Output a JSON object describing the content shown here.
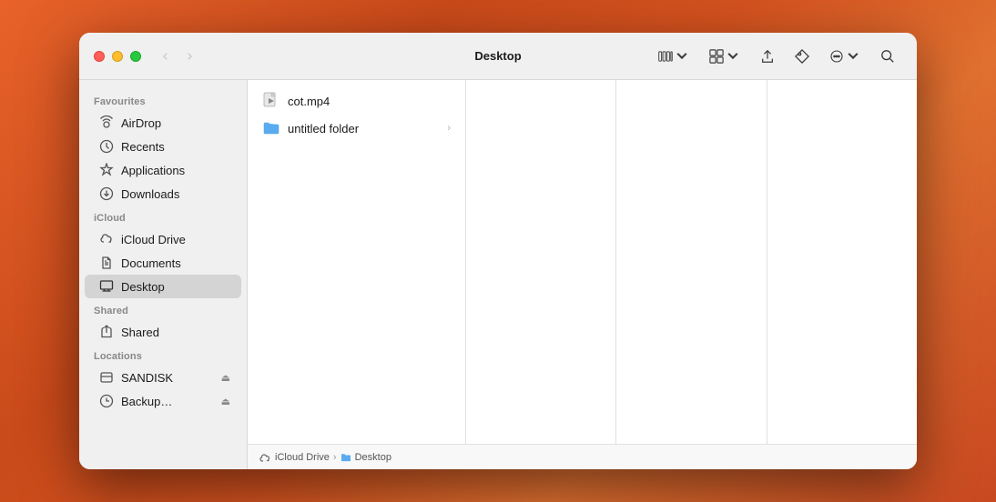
{
  "window": {
    "title": "Desktop"
  },
  "traffic_lights": {
    "close_label": "close",
    "minimize_label": "minimize",
    "maximize_label": "maximize"
  },
  "nav": {
    "back_label": "‹",
    "forward_label": "›"
  },
  "toolbar": {
    "view_columns_label": "⊞",
    "view_toggle_label": "⊟",
    "share_label": "⬆",
    "tag_label": "⬡",
    "more_label": "⊙",
    "search_label": "⌕"
  },
  "sidebar": {
    "favourites_label": "Favourites",
    "icloud_label": "iCloud",
    "shared_label": "Shared",
    "locations_label": "Locations",
    "items": [
      {
        "id": "airdrop",
        "label": "AirDrop",
        "icon": "airdrop"
      },
      {
        "id": "recents",
        "label": "Recents",
        "icon": "recents"
      },
      {
        "id": "applications",
        "label": "Applications",
        "icon": "applications"
      },
      {
        "id": "downloads",
        "label": "Downloads",
        "icon": "downloads"
      }
    ],
    "icloud_items": [
      {
        "id": "icloud-drive",
        "label": "iCloud Drive",
        "icon": "cloud"
      },
      {
        "id": "documents",
        "label": "Documents",
        "icon": "document"
      },
      {
        "id": "desktop",
        "label": "Desktop",
        "icon": "desktop",
        "active": true
      }
    ],
    "shared_items": [
      {
        "id": "shared",
        "label": "Shared",
        "icon": "shared"
      }
    ],
    "location_items": [
      {
        "id": "sandisk",
        "label": "SANDISK",
        "icon": "drive",
        "eject": true
      },
      {
        "id": "backup",
        "label": "Backup…",
        "icon": "drive-backup",
        "eject": true
      }
    ]
  },
  "files": [
    {
      "id": "cot-mp4",
      "name": "cot.mp4",
      "icon": "video",
      "has_arrow": false
    },
    {
      "id": "untitled-folder",
      "name": "untitled folder",
      "icon": "folder",
      "has_arrow": true
    }
  ],
  "breadcrumb": {
    "parts": [
      {
        "label": "iCloud Drive",
        "icon": "cloud-small"
      },
      {
        "label": "Desktop",
        "icon": "folder-small"
      }
    ]
  },
  "colors": {
    "active_sidebar": "#d4d4d4",
    "folder_blue": "#4a90d9",
    "tl_close": "#ff5f57",
    "tl_min": "#febc2e",
    "tl_max": "#28c840"
  }
}
